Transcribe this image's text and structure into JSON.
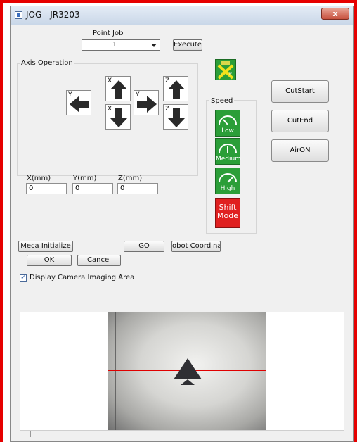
{
  "window": {
    "title": "JOG - JR3203",
    "close_label": "x"
  },
  "point_job": {
    "label": "Point Job",
    "selected": "1",
    "execute_label": "Execute"
  },
  "axis_operation": {
    "label": "Axis Operation",
    "buttons": {
      "x_plus": "X",
      "x_minus": "X",
      "y_minus": "Y",
      "y_plus": "Y",
      "z_plus": "Z",
      "z_minus": "Z"
    }
  },
  "coords": {
    "x_label": "X(mm)",
    "y_label": "Y(mm)",
    "z_label": "Z(mm)",
    "x_value": "0",
    "y_value": "0",
    "z_value": "0"
  },
  "speed": {
    "label": "Speed",
    "levels": [
      "Low",
      "Medium",
      "High"
    ],
    "shift_label": "Shift Mode",
    "tp_icon": "teach-pendant-icon",
    "accent_green": "#2b9e38",
    "shift_red": "#e02020"
  },
  "side_buttons": {
    "cut_start": "CutStart",
    "cut_end": "CutEnd",
    "air_on": "AirON"
  },
  "actions": {
    "meca_initialize": "Meca Initialize",
    "go": "GO",
    "robot_coordinate": "obot Coordinate",
    "ok": "OK",
    "cancel": "Cancel"
  },
  "display_camera": {
    "label": "Display Camera Imaging Area",
    "checked": true,
    "check_glyph": "✓"
  },
  "camera": {
    "crosshair_color": "#e00000"
  }
}
